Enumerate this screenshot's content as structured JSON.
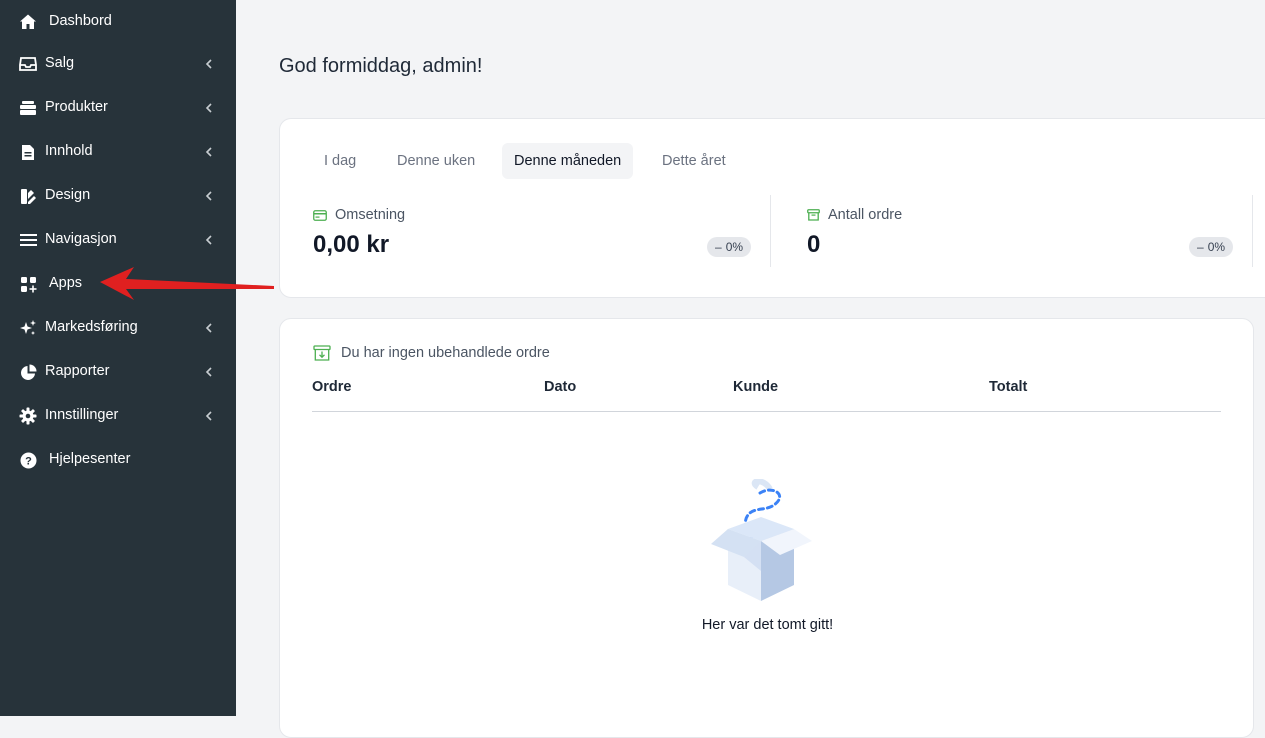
{
  "sidebar": {
    "items": [
      {
        "label": "Dashbord",
        "icon": "home-icon"
      },
      {
        "label": "Salg",
        "icon": "inbox-icon"
      },
      {
        "label": "Produkter",
        "icon": "stack-icon"
      },
      {
        "label": "Innhold",
        "icon": "document-icon"
      },
      {
        "label": "Design",
        "icon": "palette-icon"
      },
      {
        "label": "Navigasjon",
        "icon": "menu-icon"
      },
      {
        "label": "Apps",
        "icon": "apps-icon"
      },
      {
        "label": "Markedsføring",
        "icon": "sparkles-icon"
      },
      {
        "label": "Rapporter",
        "icon": "pie-chart-icon"
      },
      {
        "label": "Innstillinger",
        "icon": "gear-icon"
      },
      {
        "label": "Hjelpesenter",
        "icon": "help-icon"
      }
    ]
  },
  "main": {
    "greeting": "God formiddag, admin!",
    "tabs": [
      "I dag",
      "Denne uken",
      "Denne måneden",
      "Dette året"
    ],
    "selected_tab": "Denne måneden",
    "stats": [
      {
        "label": "Omsetning",
        "value": "0,00 kr",
        "change": "0%",
        "icon": "credit-card-icon"
      },
      {
        "label": "Antall ordre",
        "value": "0",
        "change": "0%",
        "icon": "archive-icon"
      }
    ],
    "orders": {
      "title": "Du har ingen ubehandlede ordre",
      "columns": [
        "Ordre",
        "Dato",
        "Kunde",
        "Totalt"
      ],
      "empty_text": "Her var det tomt gitt!"
    }
  },
  "colors": {
    "sidebar_bg": "#27333a",
    "accent_green": "#4caf50",
    "arrow_red": "#e02020"
  }
}
